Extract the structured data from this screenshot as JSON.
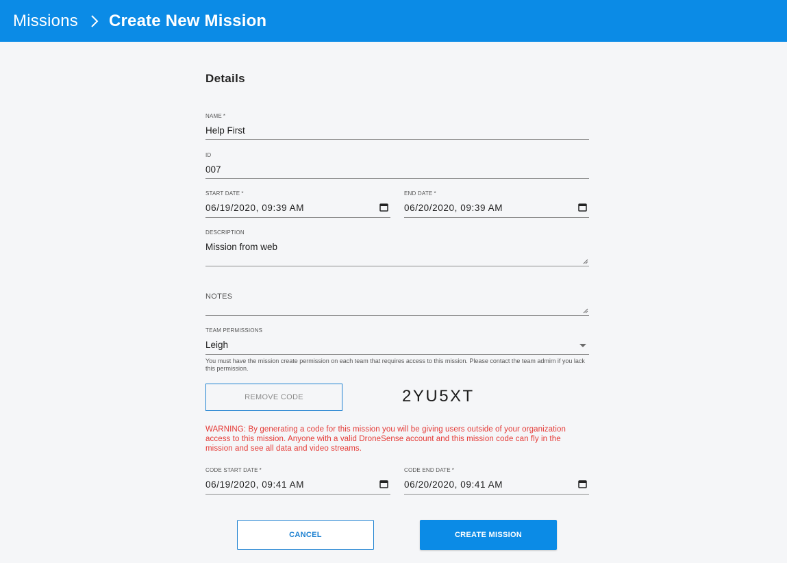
{
  "header": {
    "breadcrumb_root": "Missions",
    "breadcrumb_current": "Create New Mission"
  },
  "form": {
    "section_title": "Details",
    "name": {
      "label": "NAME",
      "required_mark": "*",
      "value": "Help First"
    },
    "id": {
      "label": "ID",
      "value": "007"
    },
    "start_date": {
      "label": "START DATE",
      "required_mark": "*",
      "value": "06/19/2020, 09:39 AM"
    },
    "end_date": {
      "label": "END DATE",
      "required_mark": "*",
      "value": "06/20/2020, 09:39 AM"
    },
    "description": {
      "label": "DESCRIPTION",
      "value": "Mission from web"
    },
    "notes": {
      "label": "NOTES",
      "value": ""
    },
    "team_permissions": {
      "label": "TEAM PERMISSIONS",
      "value": "Leigh",
      "helper": "You must have the mission create permission on each team that requires access to this mission. Please contact the team admim if you lack this permission."
    },
    "remove_code_label": "REMOVE CODE",
    "mission_code": "2YU5XT",
    "warning": "WARNING: By generating a code for this mission you will be giving users outside of your organization access to this mission. Anyone with a valid DroneSense account and this mission code can fly in the mission and see all data and video streams.",
    "code_start_date": {
      "label": "CODE START DATE",
      "required_mark": "*",
      "value": "06/19/2020, 09:41 AM"
    },
    "code_end_date": {
      "label": "CODE END DATE",
      "required_mark": "*",
      "value": "06/20/2020, 09:41 AM"
    }
  },
  "actions": {
    "cancel_label": "CANCEL",
    "create_label": "CREATE MISSION"
  },
  "colors": {
    "brand_blue": "#0b8be6",
    "outline_blue": "#1a7fd0",
    "warning_red": "#e53935",
    "background": "#f5f6f8"
  },
  "icons": {
    "breadcrumb_separator": "chevron-right-icon",
    "date_picker": "calendar-icon",
    "textarea_resize": "resize-handle-icon",
    "select": "dropdown-arrow-icon"
  }
}
